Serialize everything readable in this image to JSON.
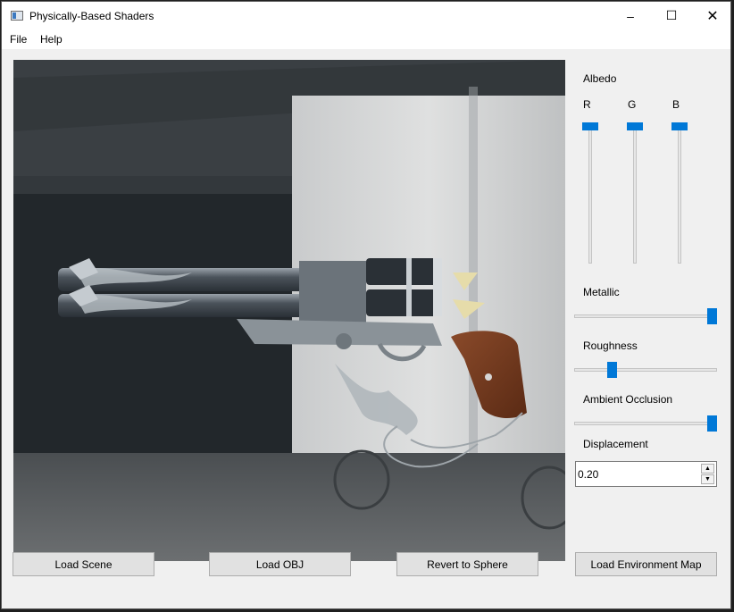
{
  "window": {
    "title": "Physically-Based Shaders",
    "controls": {
      "minimize": "–",
      "maximize": "☐",
      "close": "✕"
    },
    "icon": "app-window-icon"
  },
  "menu": [
    "File",
    "Help"
  ],
  "controls": {
    "albedo_label": "Albedo",
    "albedo_channels": [
      {
        "label": "R",
        "value": 1.0
      },
      {
        "label": "G",
        "value": 1.0
      },
      {
        "label": "B",
        "value": 1.0
      }
    ],
    "metallic": {
      "label": "Metallic",
      "value": 1.0
    },
    "roughness": {
      "label": "Roughness",
      "value": 0.25
    },
    "ambient_occlusion": {
      "label": "Ambient Occlusion",
      "value": 1.0
    },
    "displacement": {
      "label": "Displacement",
      "value": "0.20"
    }
  },
  "buttons": {
    "load_scene": "Load Scene",
    "load_obj": "Load OBJ",
    "revert": "Revert to Sphere",
    "load_env": "Load Environment Map"
  },
  "colors": {
    "accent": "#0078d7"
  }
}
